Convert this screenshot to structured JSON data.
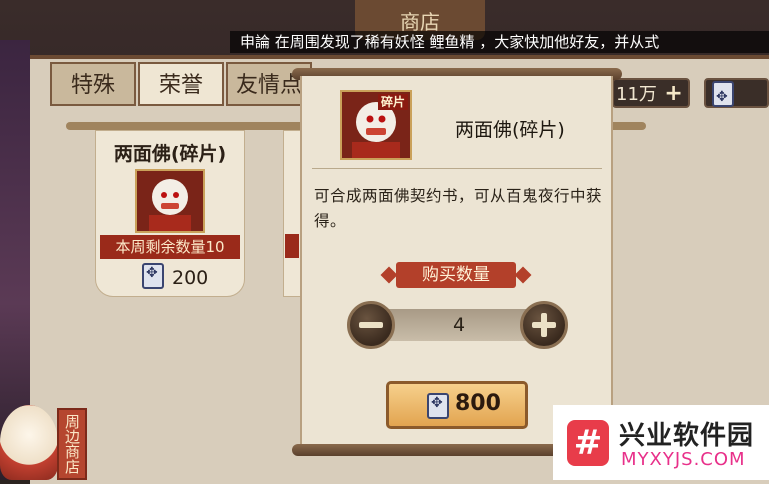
{
  "header": {
    "title": "商店"
  },
  "ticker": {
    "text": "申論 在周围发现了稀有妖怪 鲤鱼精 ，大家快加他好友，并从式"
  },
  "tabs": [
    {
      "label": "特殊"
    },
    {
      "label": "荣誉"
    },
    {
      "label": "友情点"
    }
  ],
  "currency": {
    "amount": "11万"
  },
  "shop_card": {
    "name": "两面佛(碎片)",
    "stock": "本周剩余数量10",
    "price": "200"
  },
  "popup": {
    "item_name": "两面佛(碎片)",
    "portrait_tag": "碎片",
    "description": "可合成两面佛契约书，可从百鬼夜行中获得。",
    "quantity_label": "购买数量",
    "quantity": "4",
    "total_price": "800"
  },
  "side_tag": {
    "label": "周边商店"
  },
  "watermark": {
    "logo": "#",
    "title": "兴业软件园",
    "url": "MYXYJS.COM"
  },
  "colors": {
    "accent_red": "#b3402a",
    "buy_button": "#e2a450",
    "watermark_pink": "#e8308a"
  }
}
